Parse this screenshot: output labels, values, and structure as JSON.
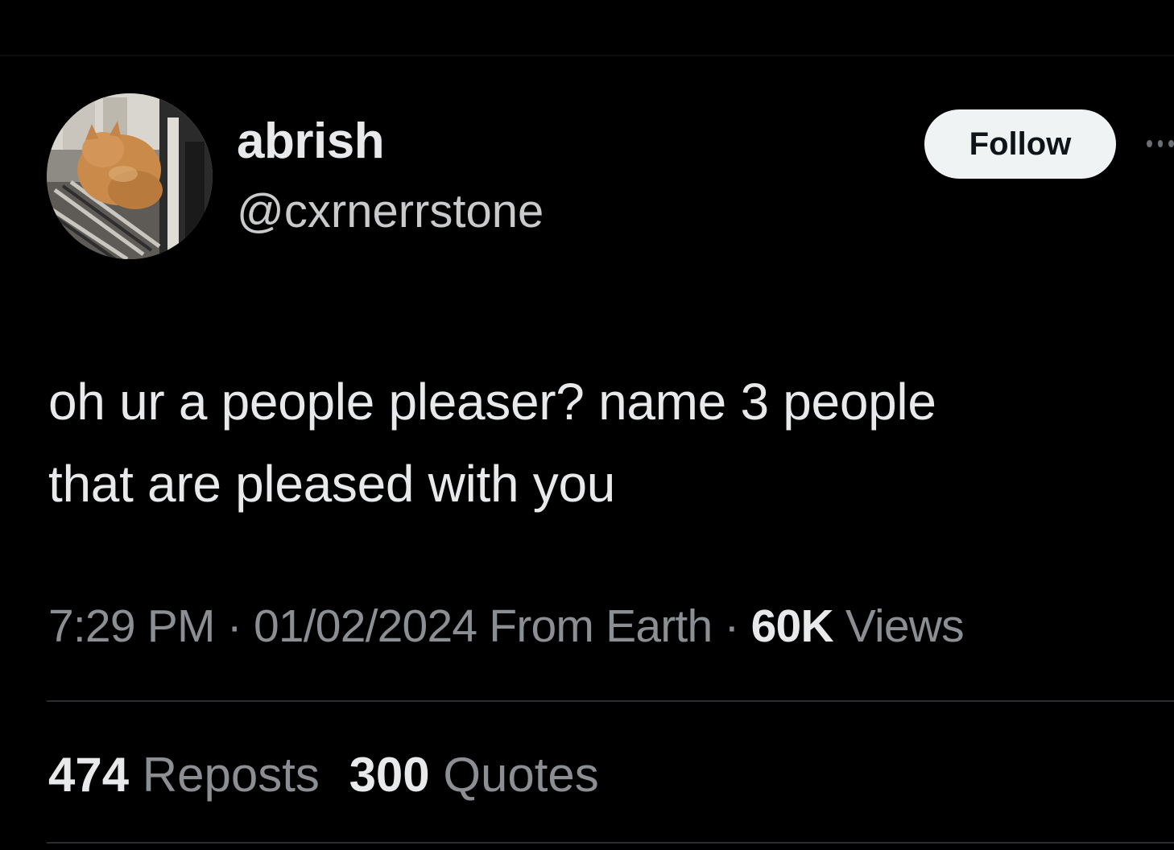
{
  "author": {
    "display_name": "abrish",
    "handle": "@cxrnerrstone"
  },
  "header": {
    "follow_label": "Follow"
  },
  "tweet": {
    "text": "oh ur a people pleaser? name 3 people\nthat are pleased with you",
    "time": "7:29 PM",
    "separator": "·",
    "date": "01/02/2024",
    "source": "From Earth",
    "views_count": "60K",
    "views_label": "Views"
  },
  "stats": {
    "reposts_count": "474",
    "reposts_label": "Reposts",
    "quotes_count": "300",
    "quotes_label": "Quotes"
  },
  "colors": {
    "background": "#000000",
    "primary_text": "#e7e9ea",
    "secondary_text": "#8b8f93",
    "follow_button_bg": "#eff3f4"
  }
}
